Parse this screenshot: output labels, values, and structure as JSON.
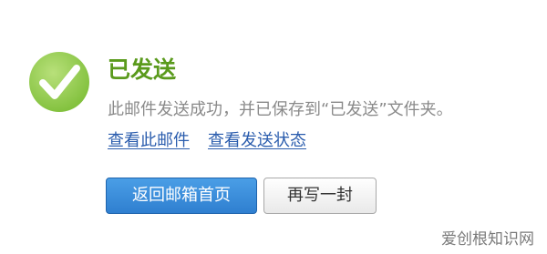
{
  "status": {
    "title": "已发送",
    "message": "此邮件发送成功，并已保存到“已发送”文件夹。",
    "icon": "checkmark-circle-icon",
    "accent_color": "#5a9a1c"
  },
  "links": {
    "view_mail": "查看此邮件",
    "view_status": "查看发送状态"
  },
  "buttons": {
    "back_to_inbox": "返回邮箱首页",
    "write_again": "再写一封"
  },
  "watermark": "爱创根知识网"
}
